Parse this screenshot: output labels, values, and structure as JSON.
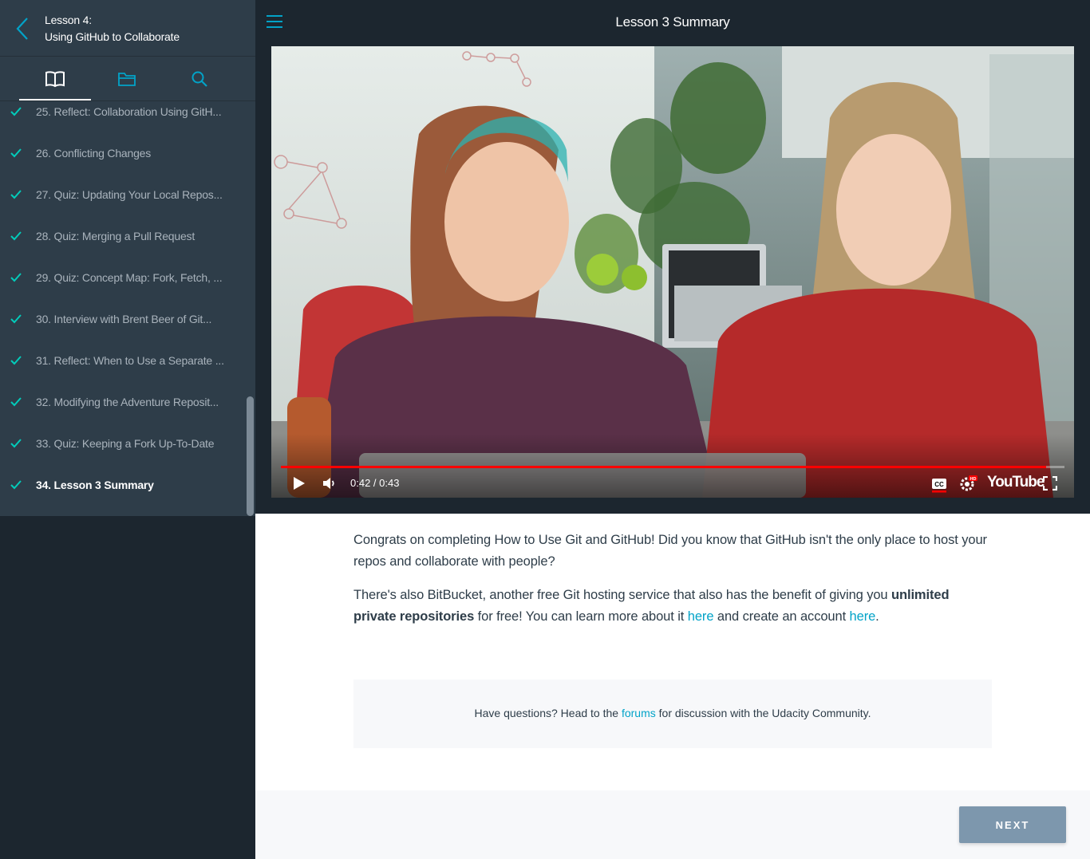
{
  "sidebar": {
    "lesson_number": "Lesson 4:",
    "lesson_title": "Using GitHub to Collaborate",
    "tabs": [
      {
        "icon": "book-icon"
      },
      {
        "icon": "folder-icon"
      },
      {
        "icon": "search-icon"
      }
    ],
    "items": [
      {
        "label": "25. Reflect: Collaboration Using GitH...",
        "completed": true
      },
      {
        "label": "26. Conflicting Changes",
        "completed": true
      },
      {
        "label": "27. Quiz: Updating Your Local Repos...",
        "completed": true
      },
      {
        "label": "28. Quiz: Merging a Pull Request",
        "completed": true
      },
      {
        "label": "29. Quiz: Concept Map: Fork, Fetch, ...",
        "completed": true
      },
      {
        "label": "30. Interview with Brent Beer of Git...",
        "completed": true
      },
      {
        "label": "31. Reflect: When to Use a Separate ...",
        "completed": true
      },
      {
        "label": "32. Modifying the Adventure Reposit...",
        "completed": true
      },
      {
        "label": "33. Quiz: Keeping a Fork Up-To-Date",
        "completed": true
      },
      {
        "label": "34. Lesson 3 Summary",
        "completed": true,
        "current": true
      }
    ]
  },
  "header": {
    "title": "Lesson 3 Summary"
  },
  "video": {
    "time_display": "0:42 / 0:43",
    "progress_fraction": 0.977,
    "brand": "YouTube",
    "buttons": [
      "play-icon",
      "volume-icon",
      "cc-icon",
      "settings-hd-icon",
      "fullscreen-icon"
    ]
  },
  "content": {
    "p1": "Congrats on completing How to Use Git and GitHub! Did you know that GitHub isn't the only place to host your repos and collaborate with people?",
    "p2_a": "There's also BitBucket, another free Git hosting service that also has the benefit of giving you ",
    "p2_bold": "unlimited private repositories",
    "p2_b": " for free! You can learn more about it ",
    "p2_link1": "here",
    "p2_c": " and create an account ",
    "p2_link2": "here",
    "p2_d": "."
  },
  "forum": {
    "text_a": "Have questions? Head to the ",
    "link": "forums",
    "text_b": " for discussion with the Udacity Community."
  },
  "footer": {
    "next_label": "NEXT"
  },
  "colors": {
    "sidebar_bg": "#2e3d49",
    "dark_bg": "#1c262f",
    "accent": "#02a3c8",
    "check": "#02ccba",
    "progress": "#ff0000",
    "next_button": "#7d97ad"
  }
}
